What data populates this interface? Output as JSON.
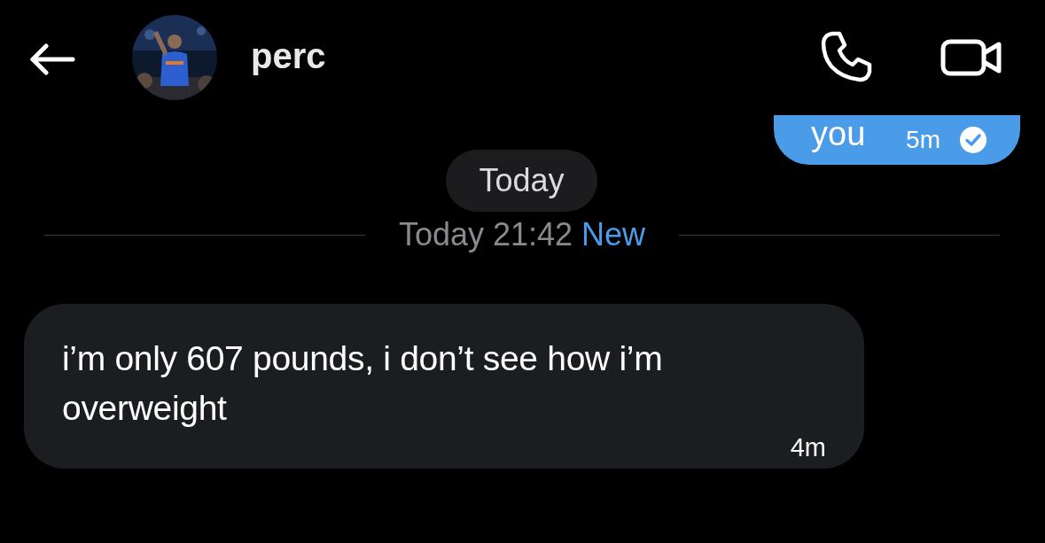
{
  "header": {
    "name": "perc"
  },
  "messages": [
    {
      "kind": "sent",
      "text": "you",
      "time": "5m",
      "read": true
    },
    {
      "kind": "date",
      "label": "Today"
    },
    {
      "kind": "unread_divider",
      "time": "Today 21:42",
      "tag": "New"
    },
    {
      "kind": "received",
      "text": "i’m only 607 pounds, i don’t see how i’m overweight",
      "time": "4m"
    }
  ]
}
